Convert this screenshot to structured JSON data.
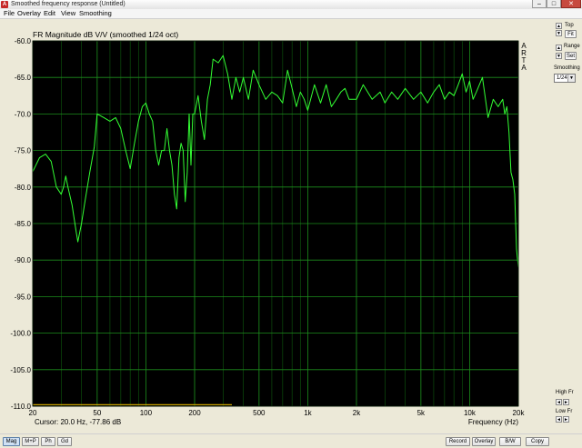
{
  "window": {
    "app_icon_glyph": "A",
    "title": "Smoothed frequency response (Untitled)",
    "minimize_glyph": "–",
    "maximize_glyph": "□",
    "close_glyph": "✕"
  },
  "menu": [
    {
      "label": "File",
      "name": "menu-file"
    },
    {
      "label": "Overlay",
      "name": "menu-overlay"
    },
    {
      "label": "Edit",
      "name": "menu-edit"
    },
    {
      "label": "View",
      "name": "menu-view"
    },
    {
      "label": "Smoothing",
      "name": "menu-smoothing"
    }
  ],
  "side_panel": {
    "top_label": "Top",
    "fit_label": "Fit",
    "range_label": "Range",
    "set_label": "Set",
    "smoothing_label": "Smoothing",
    "smoothing_value": "1/24",
    "high_fr_label": "High Fr",
    "low_fr_label": "Low Fr",
    "arrow_up": "▲",
    "arrow_down": "▼",
    "arrow_left": "◄",
    "arrow_right": "►"
  },
  "bottom_left_buttons": [
    "Mag",
    "M+P",
    "Ph",
    "Gd"
  ],
  "bottom_right_buttons": [
    "Record",
    "Overlay",
    "B/W",
    "Copy"
  ],
  "colors": {
    "plot_bg": "#000000",
    "grid": "#1c8c1c",
    "grid_minor": "#0f5a0f",
    "trace": "#33ff33",
    "overlay_trace": "#c8a000",
    "axis_text": "#000000"
  },
  "chart_data": {
    "type": "line",
    "title": "FR Magnitude dB V/V (smoothed 1/24 oct)",
    "watermark": [
      "A",
      "R",
      "T",
      "A"
    ],
    "xlabel": "Frequency (Hz)",
    "x_scale": "log",
    "xlim": [
      20,
      20000
    ],
    "ylim": [
      -110,
      -60
    ],
    "x_tick_values": [
      20,
      50,
      100,
      200,
      500,
      1000,
      2000,
      5000,
      10000,
      20000
    ],
    "x_tick_labels": [
      "20",
      "50",
      "100",
      "200",
      "500",
      "1k",
      "2k",
      "5k",
      "10k",
      "20k"
    ],
    "y_tick_values": [
      -60,
      -65,
      -70,
      -75,
      -80,
      -85,
      -90,
      -95,
      -100,
      -105,
      -110
    ],
    "y_tick_labels": [
      "-60.0",
      "-65.0",
      "-70.0",
      "-75.0",
      "-80.0",
      "-85.0",
      "-90.0",
      "-95.0",
      "-100.0",
      "-105.0",
      "-110.0"
    ],
    "cursor_text": "Cursor: 20.0 Hz, -77.86 dB",
    "grid": true,
    "series": [
      {
        "x": [
          20,
          22,
          24,
          26,
          28,
          30,
          31,
          32,
          33,
          35,
          37,
          38,
          40,
          42,
          45,
          48,
          50,
          55,
          60,
          65,
          70,
          75,
          80,
          85,
          90,
          95,
          100,
          105,
          110,
          115,
          120,
          125,
          130,
          135,
          140,
          145,
          150,
          155,
          160,
          165,
          170,
          175,
          180,
          185,
          190,
          195,
          200,
          210,
          220,
          230,
          240,
          250,
          260,
          280,
          300,
          320,
          340,
          360,
          380,
          400,
          430,
          460,
          500,
          550,
          600,
          650,
          700,
          750,
          800,
          850,
          900,
          950,
          1000,
          1100,
          1200,
          1300,
          1400,
          1500,
          1600,
          1700,
          1800,
          2000,
          2200,
          2500,
          2800,
          3000,
          3300,
          3600,
          4000,
          4500,
          5000,
          5500,
          6000,
          6500,
          7000,
          7500,
          8000,
          8500,
          9000,
          9500,
          10000,
          10500,
          11000,
          12000,
          13000,
          14000,
          15000,
          15500,
          16000,
          16500,
          17000,
          17500,
          18000,
          18500,
          19000,
          19500,
          20000
        ],
        "y": [
          -77.9,
          -76,
          -75.5,
          -76.5,
          -80,
          -81,
          -80,
          -78.5,
          -80,
          -82.5,
          -86,
          -87.5,
          -85,
          -82,
          -78,
          -74.5,
          -70,
          -70.5,
          -71,
          -70.5,
          -72,
          -75,
          -77.5,
          -74,
          -71,
          -69,
          -68.5,
          -70,
          -71,
          -75,
          -77,
          -75,
          -75,
          -72,
          -75,
          -77,
          -81,
          -83,
          -76,
          -74,
          -75,
          -82,
          -78,
          -70,
          -77,
          -70,
          -70,
          -67.5,
          -71,
          -73.5,
          -68,
          -66,
          -62.5,
          -63,
          -62,
          -64.5,
          -68,
          -65,
          -67,
          -65,
          -68,
          -64,
          -66,
          -68,
          -67,
          -67.5,
          -68.5,
          -64,
          -66.5,
          -69,
          -67,
          -68,
          -69.5,
          -66,
          -68.5,
          -66,
          -69,
          -68,
          -67,
          -66.5,
          -68,
          -68,
          -66,
          -68,
          -67,
          -68.5,
          -67,
          -68,
          -66.5,
          -68,
          -67,
          -68.5,
          -67,
          -66,
          -68,
          -67,
          -67.5,
          -66,
          -64.5,
          -67,
          -65.5,
          -68,
          -67,
          -65,
          -70.5,
          -68,
          -69,
          -68.5,
          -68,
          -70,
          -69,
          -72.5,
          -78,
          -79,
          -81,
          -88.5,
          -91
        ]
      },
      {
        "x": [
          20,
          340
        ],
        "y": [
          -109.8,
          -109.8
        ]
      }
    ]
  }
}
